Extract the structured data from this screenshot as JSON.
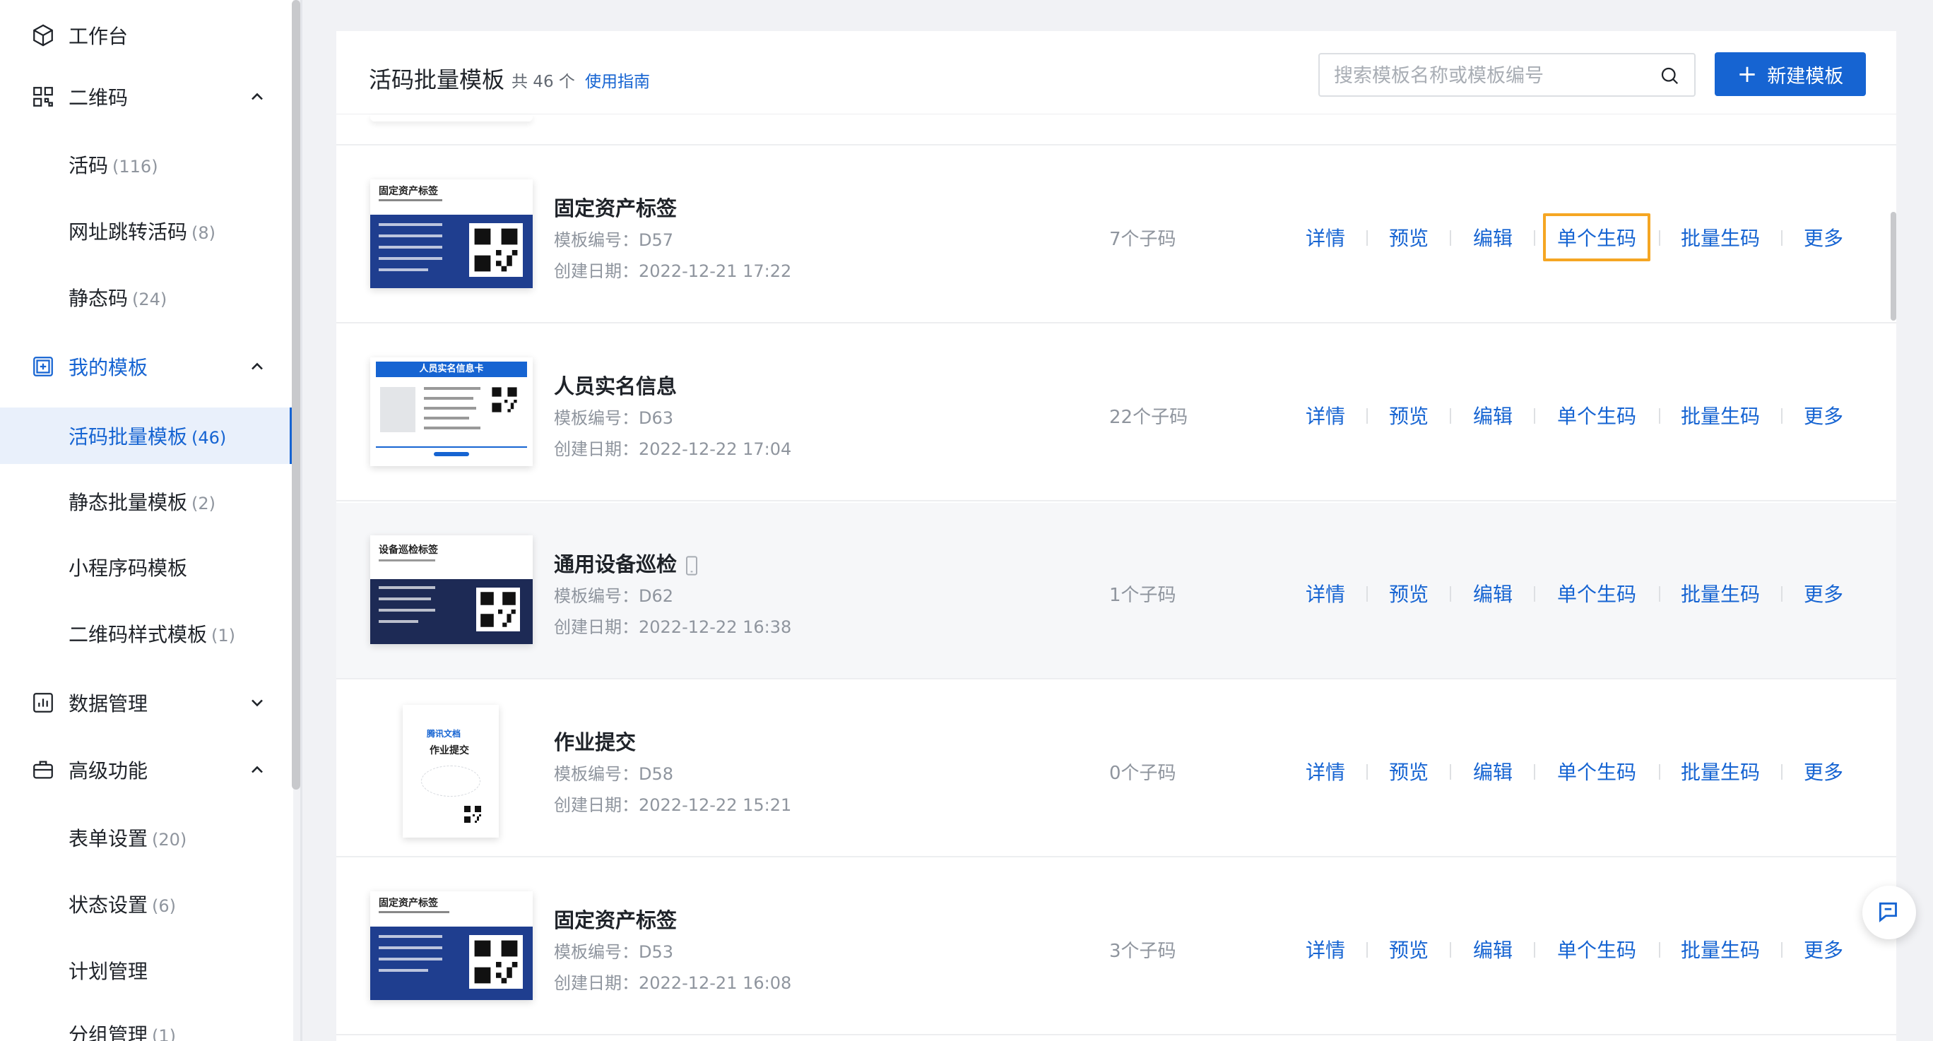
{
  "sidebar": {
    "workbench": "工作台",
    "qrcode": {
      "label": "二维码",
      "items": [
        {
          "label": "活码",
          "count": "(116)"
        },
        {
          "label": "网址跳转活码",
          "count": "(8)"
        },
        {
          "label": "静态码",
          "count": "(24)"
        }
      ]
    },
    "templates": {
      "label": "我的模板",
      "items": [
        {
          "label": "活码批量模板",
          "count": "(46)"
        },
        {
          "label": "静态批量模板",
          "count": "(2)"
        },
        {
          "label": "小程序码模板",
          "count": ""
        },
        {
          "label": "二维码样式模板",
          "count": "(1)"
        }
      ]
    },
    "data_mgmt": "数据管理",
    "advanced": {
      "label": "高级功能",
      "items": [
        {
          "label": "表单设置",
          "count": "(20)"
        },
        {
          "label": "状态设置",
          "count": "(6)"
        },
        {
          "label": "计划管理",
          "count": ""
        },
        {
          "label": "分组管理",
          "count": "(1)"
        }
      ]
    }
  },
  "header": {
    "title": "活码批量模板",
    "count": "共 46 个",
    "guide": "使用指南",
    "search_placeholder": "搜索模板名称或模板编号",
    "new_button": "新建模板"
  },
  "actions": {
    "detail": "详情",
    "preview": "预览",
    "edit": "编辑",
    "single": "单个生码",
    "batch": "批量生码",
    "more": "更多"
  },
  "rows": [
    {
      "name": "固定资产标签",
      "code": "模板编号：D57",
      "date": "创建日期：2022-12-21 17:22",
      "subcodes": "7个子码"
    },
    {
      "name": "人员实名信息",
      "code": "模板编号：D63",
      "date": "创建日期：2022-12-22 17:04",
      "subcodes": "22个子码"
    },
    {
      "name": "通用设备巡检",
      "code": "模板编号：D62",
      "date": "创建日期：2022-12-22 16:38",
      "subcodes": "1个子码"
    },
    {
      "name": "作业提交",
      "code": "模板编号：D58",
      "date": "创建日期：2022-12-22 15:21",
      "subcodes": "0个子码"
    },
    {
      "name": "固定资产标签",
      "code": "模板编号：D53",
      "date": "创建日期：2022-12-21 16:08",
      "subcodes": "3个子码"
    }
  ],
  "thumbnails": {
    "asset1_title": "固定资产标签",
    "person_title": "人员实名信息卡",
    "inspect_title": "设备巡检标签",
    "doc_brand": "腾讯文档",
    "doc_title": "作业提交",
    "asset2_title": "固定资产标签"
  },
  "colors": {
    "accent": "#1664d2",
    "focus": "#f5a623",
    "card_blue": "#1f3e8f",
    "card_navy": "#1d2a55"
  }
}
